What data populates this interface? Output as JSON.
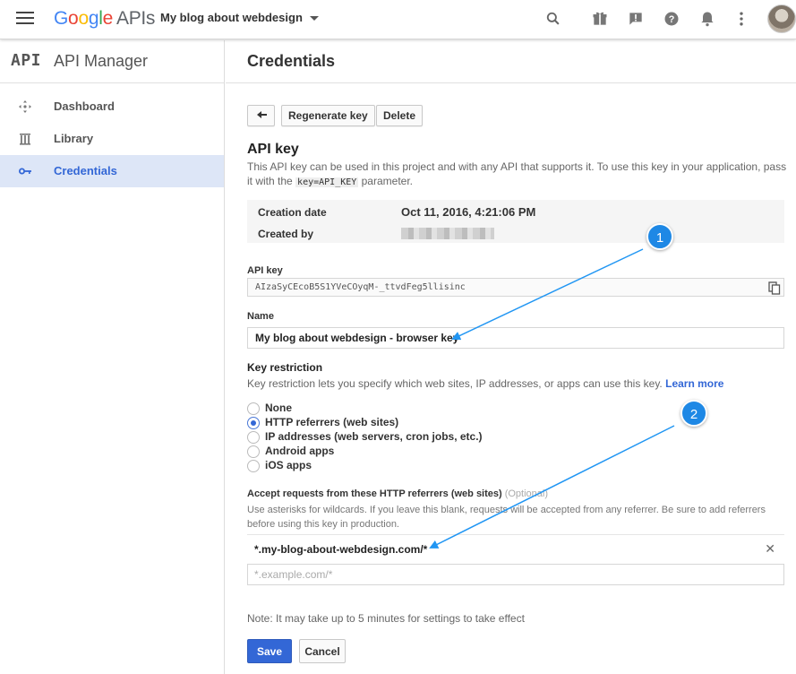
{
  "topbar": {
    "logo_google": "Google",
    "logo_apis": "APIs",
    "project_name": "My blog about webdesign",
    "icons": [
      "search-icon",
      "gift-icon",
      "alert-icon",
      "help-icon",
      "notifications-icon",
      "more-vert-icon"
    ]
  },
  "sidebar": {
    "glyph": "API",
    "title": "API Manager",
    "items": [
      {
        "label": "Dashboard",
        "icon": "dashboard-icon"
      },
      {
        "label": "Library",
        "icon": "library-icon"
      },
      {
        "label": "Credentials",
        "icon": "key-icon",
        "active": true
      }
    ]
  },
  "main": {
    "title": "Credentials",
    "toolbar": {
      "regenerate_label": "Regenerate key",
      "delete_label": "Delete"
    },
    "api_key_heading": "API key",
    "description": {
      "part1": "This API key can be used in this project and with any API that supports it. To use this key in your application, pass it with the",
      "code": "key=API_KEY",
      "part2": "parameter."
    },
    "meta": {
      "creation_date_label": "Creation date",
      "creation_date_value": "Oct 11, 2016, 4:21:06 PM",
      "created_by_label": "Created by"
    },
    "api_key_label": "API key",
    "api_key_value": "AIzaSyCEcoB5S1YVeCOyqM-_ttvdFeg5llisinc",
    "name_label": "Name",
    "name_value": "My blog about webdesign - browser key",
    "restriction_heading": "Key restriction",
    "restriction_desc": "Key restriction lets you specify which web sites, IP addresses, or apps can use this key.",
    "learn_more": "Learn more",
    "restriction_options": [
      {
        "label": "None",
        "checked": false
      },
      {
        "label": "HTTP referrers (web sites)",
        "checked": true
      },
      {
        "label": "IP addresses (web servers, cron jobs, etc.)",
        "checked": false
      },
      {
        "label": "Android apps",
        "checked": false
      },
      {
        "label": "iOS apps",
        "checked": false
      }
    ],
    "accept_heading": "Accept requests from these HTTP referrers (web sites)",
    "accept_optional": "(Optional)",
    "accept_desc": "Use asterisks for wildcards. If you leave this blank, requests will be accepted from any referrer. Be sure to add referrers before using this key in production.",
    "referrer_value": "*.my-blog-about-webdesign.com/*",
    "referrer_placeholder": "*.example.com/*",
    "note": "Note: It may take up to 5 minutes for settings to take effect",
    "save_label": "Save",
    "cancel_label": "Cancel"
  },
  "annotations": {
    "badge1": "1",
    "badge2": "2",
    "arrow_color": "#2196f3"
  },
  "colors": {
    "accent": "#3367d6",
    "active_bg": "#dde6f7"
  }
}
